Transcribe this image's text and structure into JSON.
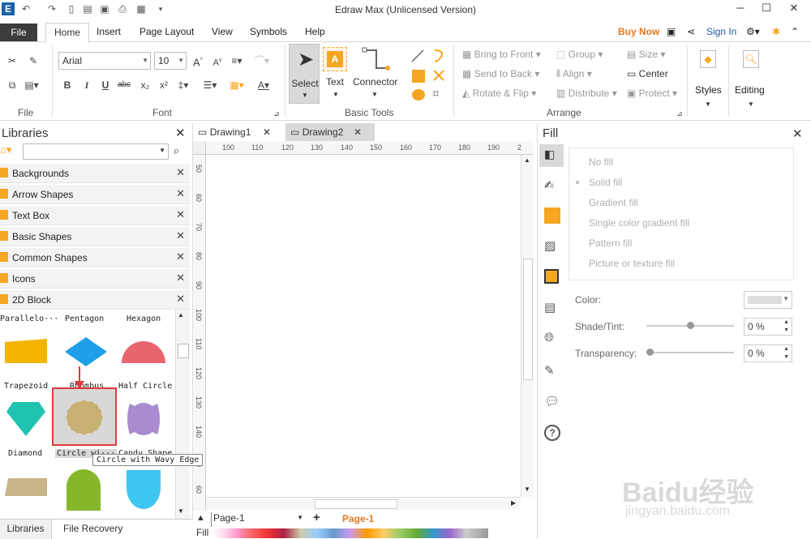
{
  "app": {
    "title": "Edraw Max (Unlicensed Version)"
  },
  "menu": {
    "file": "File",
    "items": [
      "Home",
      "Insert",
      "Page Layout",
      "View",
      "Symbols",
      "Help"
    ],
    "buy_now": "Buy Now",
    "sign_in": "Sign In"
  },
  "ribbon": {
    "file_group": "File",
    "font_group": "Font",
    "font_name": "Arial",
    "font_size": "10",
    "basic_tools_group": "Basic Tools",
    "select": "Select",
    "text": "Text",
    "connector": "Connector",
    "arrange_group": "Arrange",
    "bring_to_front": "Bring to Front",
    "send_to_back": "Send to Back",
    "rotate_flip": "Rotate & Flip",
    "group": "Group",
    "align": "Align",
    "distribute": "Distribute",
    "size": "Size",
    "center": "Center",
    "protect": "Protect",
    "styles": "Styles",
    "editing": "Editing"
  },
  "libraries": {
    "title": "Libraries",
    "categories": [
      "Backgrounds",
      "Arrow Shapes",
      "Text Box",
      "Basic Shapes",
      "Common Shapes",
      "Icons",
      "2D Block"
    ],
    "shape_top_labels": [
      "Parallelo···",
      "Pentagon",
      "Hexagon"
    ],
    "shape_row1_labels": [
      "Trapezoid",
      "Rhombus",
      "Half Circle"
    ],
    "shape_row2_labels": [
      "Diamond",
      "Circle wi···",
      "Candy Shape"
    ],
    "tooltip": "Circle with Wavy Edge",
    "bottom_tabs": [
      "Libraries",
      "File Recovery"
    ]
  },
  "documents": {
    "tabs": [
      "Drawing1",
      "Drawing2"
    ]
  },
  "rulers": {
    "horizontal": [
      "100",
      "110",
      "120",
      "130",
      "140",
      "150",
      "160",
      "170",
      "180",
      "190",
      "2"
    ],
    "vertical": [
      "50",
      "60",
      "70",
      "80",
      "90",
      "100",
      "110",
      "120",
      "130",
      "140",
      "150",
      "60"
    ]
  },
  "pagebar": {
    "page_select": "Page-1",
    "active_page": "Page-1",
    "fill_label": "Fill"
  },
  "fill_panel": {
    "title": "Fill",
    "options": [
      "No fill",
      "Solid fill",
      "Gradient fill",
      "Single color gradient fill",
      "Pattern fill",
      "Picture or texture fill"
    ],
    "color_label": "Color:",
    "shade_label": "Shade/Tint:",
    "shade_value": "0 %",
    "transparency_label": "Transparency:",
    "transparency_value": "0 %"
  },
  "colors": {
    "accent_orange": "#f5a623",
    "rhombus_blue": "#1e9fe8",
    "trapezoid_yellow": "#f4b400",
    "half_circle_pink": "#e8646e",
    "diamond_teal": "#1fc4b0",
    "wavy_circle_tan": "#c8b074",
    "candy_purple": "#a98bd0",
    "highlight_red": "#e03a3a"
  },
  "watermark": {
    "brand": "Baidu经验",
    "url": "jingyan.baidu.com"
  }
}
